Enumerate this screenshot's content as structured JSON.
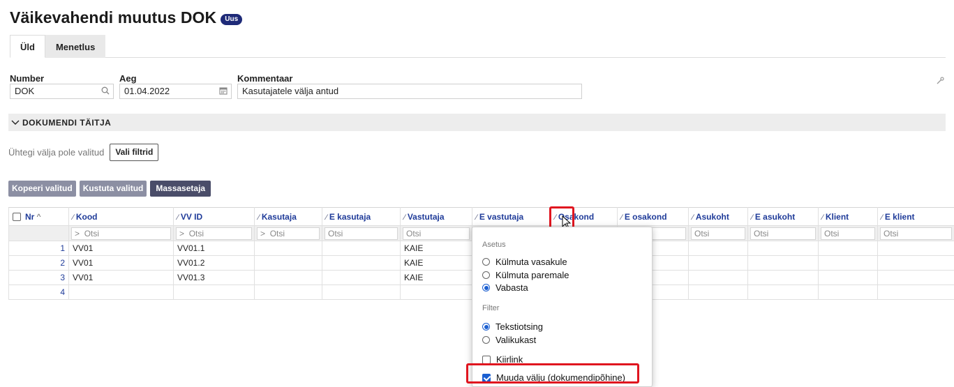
{
  "page": {
    "title": "Väikevahendi muutus DOK",
    "badge": "Uus"
  },
  "tabs": [
    {
      "label": "Üld",
      "active": true
    },
    {
      "label": "Menetlus",
      "active": false
    }
  ],
  "fields": {
    "number": {
      "label": "Number",
      "value": "DOK"
    },
    "aeg": {
      "label": "Aeg",
      "value": "01.04.2022"
    },
    "kommentaar": {
      "label": "Kommentaar",
      "value": "Kasutajatele välja antud"
    }
  },
  "section": {
    "title": "DOKUMENDI TÄITJA"
  },
  "filters": {
    "message": "Ühtegi välja pole valitud",
    "button": "Vali filtrid"
  },
  "actions": {
    "copy": "Kopeeri valitud",
    "delete": "Kustuta valitud",
    "mass": "Massasetaja"
  },
  "grid": {
    "columns": [
      "Nr",
      "Kood",
      "VV ID",
      "Kasutaja",
      "E kasutaja",
      "Vastutaja",
      "E vastutaja",
      "Osakond",
      "E osakond",
      "Asukoht",
      "E asukoht",
      "Klient",
      "E klient"
    ],
    "search_placeholder": "Otsi",
    "rows": [
      {
        "nr": "1",
        "kood": "VV01",
        "vvid": "VV01.1",
        "vastutaja": "KAIE"
      },
      {
        "nr": "2",
        "kood": "VV01",
        "vvid": "VV01.2",
        "vastutaja": "KAIE"
      },
      {
        "nr": "3",
        "kood": "VV01",
        "vvid": "VV01.3",
        "vastutaja": "KAIE"
      },
      {
        "nr": "4",
        "kood": "",
        "vvid": "",
        "vastutaja": ""
      }
    ]
  },
  "popup": {
    "group_asetus": "Asetus",
    "asetus_options": [
      {
        "label": "Külmuta vasakule",
        "selected": false
      },
      {
        "label": "Külmuta paremale",
        "selected": false
      },
      {
        "label": "Vabasta",
        "selected": true
      }
    ],
    "group_filter": "Filter",
    "filter_options": [
      {
        "label": "Tekstiotsing",
        "selected": true
      },
      {
        "label": "Valikukast",
        "selected": false
      }
    ],
    "kiirlink": {
      "label": "Kiirlink",
      "checked": false
    },
    "muuda": {
      "label": "Muuda välju (dokumendipõhine)",
      "checked": true
    }
  },
  "colors": {
    "accent": "#1f3b99",
    "highlight": "#e0151f",
    "badge": "#1e2a78"
  }
}
